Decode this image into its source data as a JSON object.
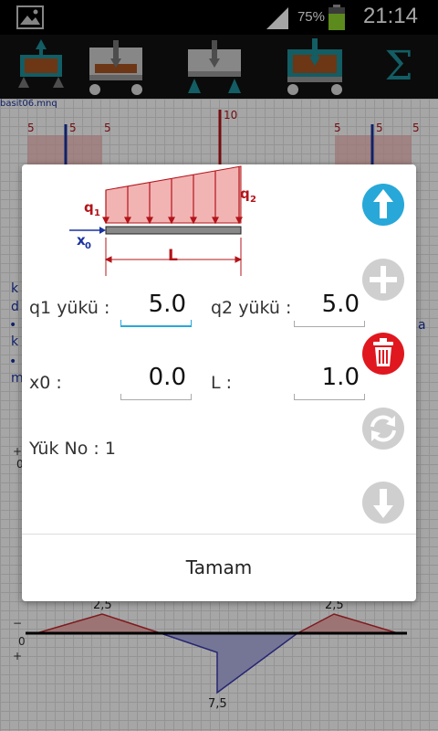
{
  "status": {
    "battery_pct": "75%",
    "time": "21:14"
  },
  "toolbar": {
    "sum_symbol": "Σ"
  },
  "canvas": {
    "filename": "basit06.mnq",
    "top_labels": [
      "5",
      "5",
      "5",
      "10",
      "5",
      "5",
      "5"
    ],
    "left_fragments": [
      "k",
      "d",
      "•",
      "k",
      "•",
      "m"
    ],
    "right_fragments": [
      "a"
    ],
    "side_signs": [
      "+",
      "0",
      "−",
      "0",
      "+"
    ],
    "diagram_values": [
      "2,5",
      "2,5",
      "7,5"
    ]
  },
  "dialog": {
    "diagram_labels": {
      "q1": "q",
      "q1_sub": "1",
      "q2": "q",
      "q2_sub": "2",
      "x0": "x",
      "x0_sub": "0",
      "L": "L"
    },
    "q1_label": "q1 yükü :",
    "q1_value": "5.0",
    "q2_label": "q2 yükü :",
    "q2_value": "5.0",
    "x0_label": "x0 :",
    "x0_value": "0.0",
    "L_label": "L :",
    "L_value": "1.0",
    "load_no": "Yük No : 1",
    "ok_label": "Tamam"
  },
  "colors": {
    "accent": "#27a8d8",
    "delete": "#e0171f",
    "disabled": "#cfcfcf"
  }
}
